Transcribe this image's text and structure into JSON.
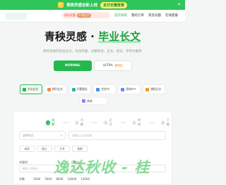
{
  "banner": {
    "message": "青秧灵感全新上线",
    "cta": "支付无需登录",
    "close": "×"
  },
  "header": {
    "vip_text": "限时优惠",
    "vip_tag": "开通会员",
    "nav": [
      "首页导航",
      "我的订单",
      "常见问题",
      "在线客服"
    ]
  },
  "hero": {
    "title_prefix": "青秧灵感 · ",
    "title_highlight": "毕业长文",
    "subtitle": "原创优质的毕业论文，包括开题、文献综述、正文、结论、参考文献等"
  },
  "modes": {
    "normal": "NORMAL",
    "ultra": "ULTRA",
    "ultra_tag": "更专业"
  },
  "categories": [
    {
      "label": "毕业论文",
      "color": "#2fb854"
    },
    {
      "label": "期刊论文",
      "color": "#f08b4a"
    },
    {
      "label": "开题报告",
      "color": "#25b7a4"
    },
    {
      "label": "任务书",
      "color": "#4a90e2"
    },
    {
      "label": "答辩PPT",
      "color": "#5b8ff9"
    },
    {
      "label": "课程论文",
      "color": "#f59a23"
    }
  ],
  "category_extra": {
    "label": "其他"
  },
  "form": {
    "steps": [
      "选题",
      "大纲",
      "正文",
      "完成",
      "下载"
    ],
    "select_placeholder": "选择科目",
    "title_placeholder": "请输入论文标题",
    "chips": [
      "本科",
      "硕士",
      "大专",
      "其他"
    ],
    "kw_label": "关键词",
    "kw2_label": "自定义",
    "kw1_placeholder": "请输入关键词",
    "kw2_placeholder": "可不填",
    "wordcount_label": "字数",
    "wordcount_options": [
      "3000",
      "5000",
      "8000",
      "10000",
      "12000"
    ]
  },
  "watermark": "逸达秋收 - 桂"
}
